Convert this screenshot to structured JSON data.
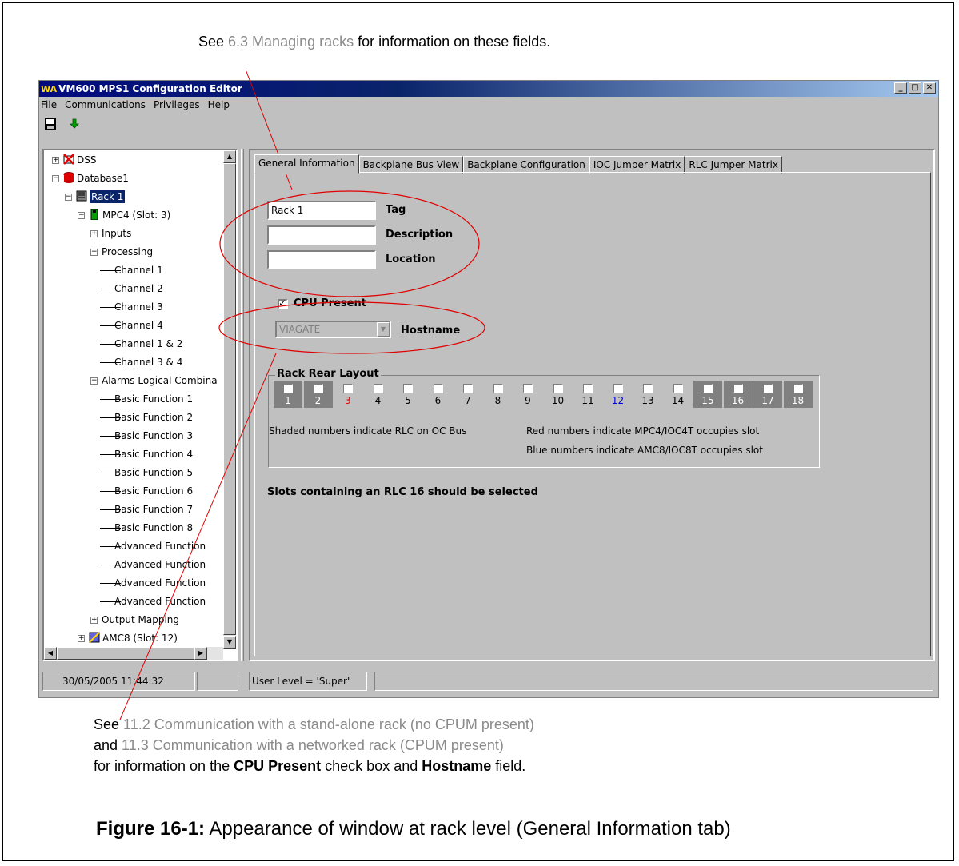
{
  "annotations": {
    "top": {
      "pre": "See ",
      "link": "6.3 Managing racks",
      "post": " for information on these fields."
    },
    "bottom_line1": {
      "pre": "See ",
      "link": "11.2 Communication with a stand-alone rack (no CPUM present)"
    },
    "bottom_line2": {
      "pre": "and ",
      "link": "11.3 Communication with a networked rack (CPUM present)"
    },
    "bottom_line3": {
      "pre": "for information on the ",
      "bold1": "CPU Present",
      "mid": " check box and ",
      "bold2": "Hostname",
      "post": " field."
    }
  },
  "caption": {
    "bold": "Figure 16-1:",
    "text": " Appearance of window at rack level (General Information tab)"
  },
  "window": {
    "title": "VM600 MPS1 Configuration Editor",
    "title_icon": "WA",
    "controls": [
      "_",
      "□",
      "✕"
    ],
    "menu": [
      "File",
      "Communications",
      "Privileges",
      "Help"
    ],
    "toolbar_icons": [
      "save-icon",
      "download-icon"
    ]
  },
  "tree": {
    "items": [
      {
        "label": "DSS",
        "icon": "dss-icon"
      },
      {
        "label": "Database1",
        "icon": "database-icon"
      },
      {
        "label": "Rack 1",
        "icon": "rack-icon",
        "selected": true
      },
      {
        "label": "MPC4 (Slot:  3)",
        "icon": "mpc4-icon"
      },
      {
        "label": "Inputs"
      },
      {
        "label": "Processing"
      },
      {
        "label": "Channel 1"
      },
      {
        "label": "Channel 2"
      },
      {
        "label": "Channel 3"
      },
      {
        "label": "Channel 4"
      },
      {
        "label": "Channel 1 & 2"
      },
      {
        "label": "Channel 3 & 4"
      },
      {
        "label": "Alarms Logical Combina"
      },
      {
        "label": "Basic Function 1"
      },
      {
        "label": "Basic Function 2"
      },
      {
        "label": "Basic Function 3"
      },
      {
        "label": "Basic Function 4"
      },
      {
        "label": "Basic Function 5"
      },
      {
        "label": "Basic Function 6"
      },
      {
        "label": "Basic Function 7"
      },
      {
        "label": "Basic Function 8"
      },
      {
        "label": "Advanced Function"
      },
      {
        "label": "Advanced Function"
      },
      {
        "label": "Advanced Function"
      },
      {
        "label": "Advanced Function"
      },
      {
        "label": "Output Mapping"
      },
      {
        "label": "AMC8 (Slot: 12)",
        "icon": "amc8-icon"
      }
    ]
  },
  "tabs": [
    "General Information",
    "Backplane Bus View",
    "Backplane Configuration",
    "IOC Jumper Matrix",
    "RLC Jumper Matrix"
  ],
  "form": {
    "tag_value": "Rack 1",
    "tag_label": "Tag",
    "description_value": "",
    "description_label": "Description",
    "location_value": "",
    "location_label": "Location",
    "cpu_present_label": "CPU Present",
    "cpu_present_checked": true,
    "hostname_value": "VIAGATE",
    "hostname_label": "Hostname"
  },
  "rack_layout": {
    "title": "Rack Rear Layout",
    "slots": [
      {
        "n": "1",
        "shaded": true,
        "color": ""
      },
      {
        "n": "2",
        "shaded": true,
        "color": ""
      },
      {
        "n": "3",
        "shaded": false,
        "color": "#e00000"
      },
      {
        "n": "4",
        "shaded": false,
        "color": ""
      },
      {
        "n": "5",
        "shaded": false,
        "color": ""
      },
      {
        "n": "6",
        "shaded": false,
        "color": ""
      },
      {
        "n": "7",
        "shaded": false,
        "color": ""
      },
      {
        "n": "8",
        "shaded": false,
        "color": ""
      },
      {
        "n": "9",
        "shaded": false,
        "color": ""
      },
      {
        "n": "10",
        "shaded": false,
        "color": ""
      },
      {
        "n": "11",
        "shaded": false,
        "color": ""
      },
      {
        "n": "12",
        "shaded": false,
        "color": "#0000e0"
      },
      {
        "n": "13",
        "shaded": false,
        "color": ""
      },
      {
        "n": "14",
        "shaded": false,
        "color": ""
      },
      {
        "n": "15",
        "shaded": true,
        "color": ""
      },
      {
        "n": "16",
        "shaded": true,
        "color": ""
      },
      {
        "n": "17",
        "shaded": true,
        "color": ""
      },
      {
        "n": "18",
        "shaded": true,
        "color": ""
      }
    ],
    "note_shaded": "Shaded numbers indicate RLC on OC Bus",
    "note_red": "Red numbers indicate MPC4/IOC4T occupies slot",
    "note_blue": "Blue numbers indicate AMC8/IOC8T occupies slot"
  },
  "rlc_note": "Slots containing an RLC 16 should be selected",
  "status": {
    "datetime": "30/05/2005 11:44:32",
    "pane2": "",
    "user_level": "User Level = 'Super'",
    "pane4": ""
  },
  "colors": {
    "highlight_ellipse": "#e00000",
    "title_gradient_start": "#000a80",
    "link_gray": "#8a8a8a"
  }
}
